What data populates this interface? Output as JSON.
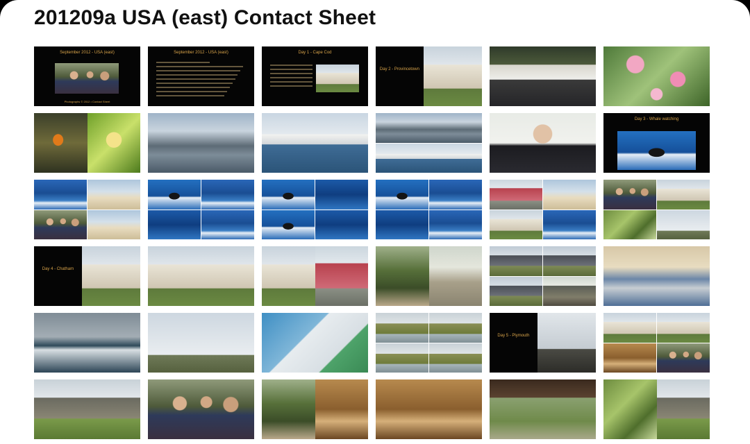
{
  "title": "201209a USA (east) Contact Sheet",
  "thumbnails": [
    {
      "kind": "slide",
      "caption": "September 2012 - USA (east)",
      "credit": "Photographs © 2012 • Contact Sheet"
    },
    {
      "kind": "textslide",
      "caption": "September 2012 - USA (east)"
    },
    {
      "kind": "slide-inset",
      "caption": "Day 1 - Cape Cod"
    },
    {
      "kind": "slide-split",
      "caption": "Day 2 - Provincetown"
    },
    {
      "kind": "photo",
      "palette": "deck"
    },
    {
      "kind": "photo",
      "palette": "flowers"
    },
    {
      "kind": "split",
      "palettes": [
        "fish",
        "lily"
      ]
    },
    {
      "kind": "photo",
      "palette": "harbor"
    },
    {
      "kind": "photo",
      "palette": "boats"
    },
    {
      "kind": "quad2",
      "palettes": [
        "harbor",
        "boats"
      ]
    },
    {
      "kind": "photo",
      "palette": "man"
    },
    {
      "kind": "slide-photo",
      "caption": "Day 3 - Whale watching"
    },
    {
      "kind": "quad",
      "palettes": [
        "sea",
        "beach",
        "people",
        "beach"
      ]
    },
    {
      "kind": "quad",
      "palettes": [
        "whale",
        "sea",
        "seadeep",
        "sea"
      ]
    },
    {
      "kind": "quad",
      "palettes": [
        "whale",
        "seadeep",
        "whale",
        "seadeep"
      ]
    },
    {
      "kind": "quad",
      "palettes": [
        "whale",
        "sea",
        "seadeep",
        "sea"
      ]
    },
    {
      "kind": "quad",
      "palettes": [
        "housered",
        "beach",
        "house",
        "sea"
      ]
    },
    {
      "kind": "quad",
      "palettes": [
        "people",
        "house",
        "green",
        "lighthouse"
      ]
    },
    {
      "kind": "slide-split",
      "caption": "Day 4 - Chatham"
    },
    {
      "kind": "photo",
      "palette": "house"
    },
    {
      "kind": "split",
      "palettes": [
        "house",
        "housered"
      ]
    },
    {
      "kind": "split",
      "palettes": [
        "forest",
        "gazebo"
      ]
    },
    {
      "kind": "quad",
      "palettes": [
        "shingle",
        "shingle",
        "shingle",
        "porch"
      ]
    },
    {
      "kind": "photo",
      "palette": "horizon"
    },
    {
      "kind": "photo",
      "palette": "surf"
    },
    {
      "kind": "split",
      "palettes": [
        "lighthouse",
        "lighthouse"
      ]
    },
    {
      "kind": "photo",
      "palette": "map"
    },
    {
      "kind": "quad",
      "palettes": [
        "marsh",
        "marsh",
        "marsh",
        "marsh"
      ]
    },
    {
      "kind": "slide-split",
      "caption": "Day 5 - Plymouth"
    },
    {
      "kind": "quad",
      "palettes": [
        "house",
        "house",
        "interior",
        "people"
      ]
    },
    {
      "kind": "photo",
      "palette": "cottage"
    },
    {
      "kind": "photo",
      "palette": "people"
    },
    {
      "kind": "split",
      "palettes": [
        "forest",
        "interior"
      ]
    },
    {
      "kind": "split",
      "palettes": [
        "interior",
        "interior"
      ]
    },
    {
      "kind": "photo",
      "palette": "pavilion"
    },
    {
      "kind": "split",
      "palettes": [
        "green",
        "cottage"
      ]
    }
  ]
}
